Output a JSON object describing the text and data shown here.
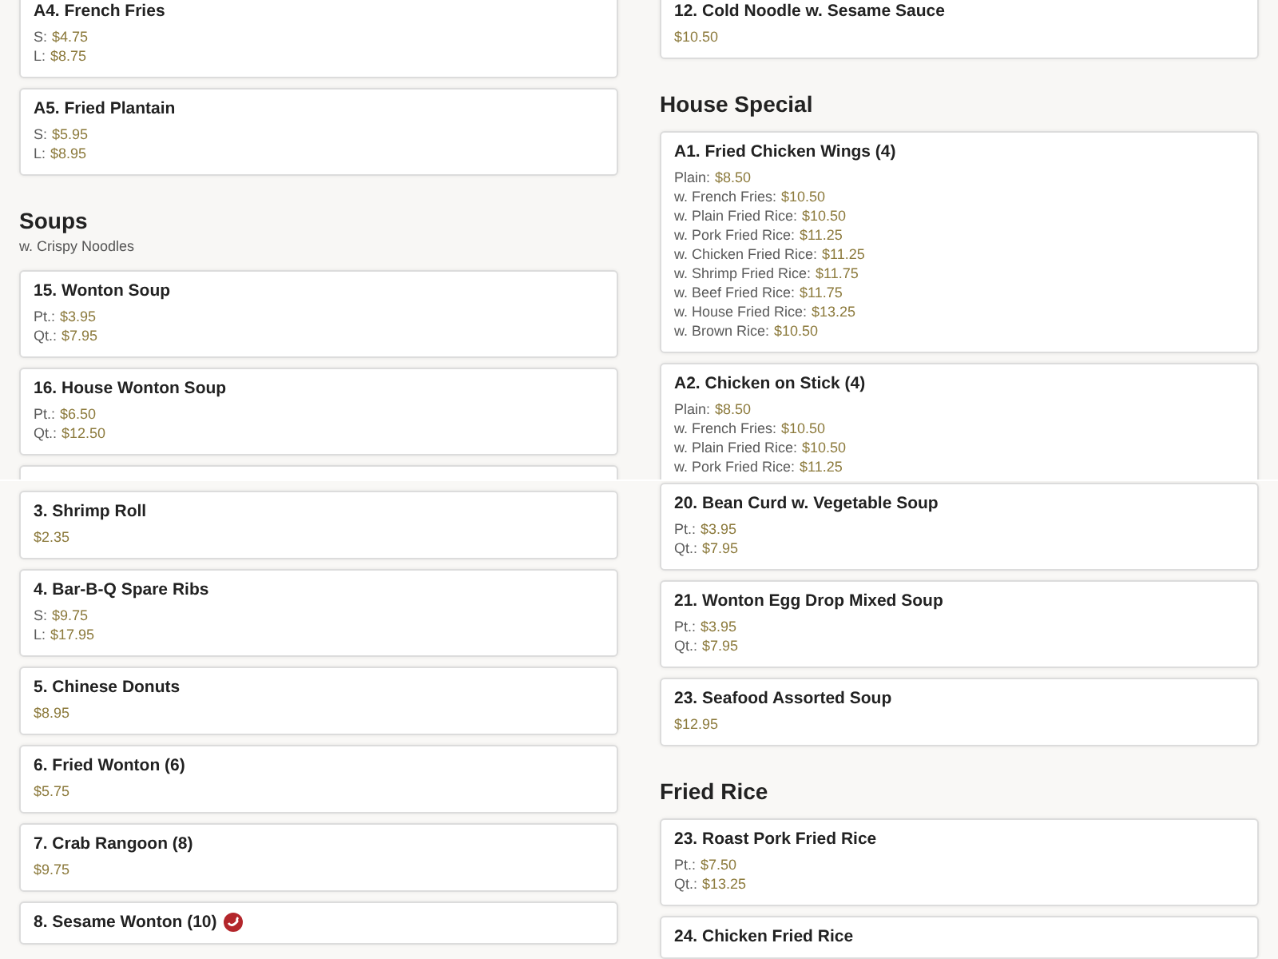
{
  "panels": [
    {
      "columns": [
        [
          {
            "kind": "card",
            "title": "A4. French Fries",
            "lines": [
              {
                "label": "S:",
                "price": "$4.75"
              },
              {
                "label": "L:",
                "price": "$8.75"
              }
            ]
          },
          {
            "kind": "card",
            "title": "A5. Fried Plantain",
            "lines": [
              {
                "label": "S:",
                "price": "$5.95"
              },
              {
                "label": "L:",
                "price": "$8.95"
              }
            ]
          },
          {
            "kind": "heading",
            "text": "Soups",
            "note": "w. Crispy Noodles"
          },
          {
            "kind": "card",
            "title": "15. Wonton Soup",
            "lines": [
              {
                "label": "Pt.:",
                "price": "$3.95"
              },
              {
                "label": "Qt.:",
                "price": "$7.95"
              }
            ]
          },
          {
            "kind": "card",
            "title": "16. House Wonton Soup",
            "lines": [
              {
                "label": "Pt.:",
                "price": "$6.50"
              },
              {
                "label": "Qt.:",
                "price": "$12.50"
              }
            ]
          },
          {
            "kind": "stub"
          }
        ],
        [
          {
            "kind": "card",
            "title": "12. Cold Noodle w. Sesame Sauce",
            "lines": [
              {
                "price": "$10.50"
              }
            ]
          },
          {
            "kind": "heading",
            "text": "House Special"
          },
          {
            "kind": "card",
            "title": "A1. Fried Chicken Wings (4)",
            "lines": [
              {
                "label": "Plain:",
                "price": "$8.50"
              },
              {
                "label": "w. French Fries:",
                "price": "$10.50"
              },
              {
                "label": "w. Plain Fried Rice:",
                "price": "$10.50"
              },
              {
                "label": "w. Pork Fried Rice:",
                "price": "$11.25"
              },
              {
                "label": "w. Chicken Fried Rice:",
                "price": "$11.25"
              },
              {
                "label": "w. Shrimp Fried Rice:",
                "price": "$11.75"
              },
              {
                "label": "w. Beef Fried Rice:",
                "price": "$11.75"
              },
              {
                "label": "w. House Fried Rice:",
                "price": "$13.25"
              },
              {
                "label": "w. Brown Rice:",
                "price": "$10.50"
              }
            ]
          },
          {
            "kind": "card",
            "title": "A2. Chicken on Stick (4)",
            "lines": [
              {
                "label": "Plain:",
                "price": "$8.50"
              },
              {
                "label": "w. French Fries:",
                "price": "$10.50"
              },
              {
                "label": "w. Plain Fried Rice:",
                "price": "$10.50"
              },
              {
                "label": "w. Pork Fried Rice:",
                "price": "$11.25"
              }
            ]
          }
        ]
      ]
    },
    {
      "columns": [
        [
          {
            "kind": "card",
            "title": "3. Shrimp Roll",
            "lines": [
              {
                "price": "$2.35"
              }
            ]
          },
          {
            "kind": "card",
            "title": "4. Bar-B-Q Spare Ribs",
            "lines": [
              {
                "label": "S:",
                "price": "$9.75"
              },
              {
                "label": "L:",
                "price": "$17.95"
              }
            ]
          },
          {
            "kind": "card",
            "title": "5. Chinese Donuts",
            "lines": [
              {
                "price": "$8.95"
              }
            ]
          },
          {
            "kind": "card",
            "title": "6. Fried Wonton (6)",
            "lines": [
              {
                "price": "$5.75"
              }
            ]
          },
          {
            "kind": "card",
            "title": "7. Crab Rangoon (8)",
            "lines": [
              {
                "price": "$9.75"
              }
            ]
          },
          {
            "kind": "card",
            "title": "8. Sesame Wonton (10)",
            "spicy": true
          }
        ],
        [
          {
            "kind": "card",
            "title": "20. Bean Curd w. Vegetable Soup",
            "lines": [
              {
                "label": "Pt.:",
                "price": "$3.95"
              },
              {
                "label": "Qt.:",
                "price": "$7.95"
              }
            ]
          },
          {
            "kind": "card",
            "title": "21. Wonton Egg Drop Mixed Soup",
            "lines": [
              {
                "label": "Pt.:",
                "price": "$3.95"
              },
              {
                "label": "Qt.:",
                "price": "$7.95"
              }
            ]
          },
          {
            "kind": "card",
            "title": "23. Seafood Assorted Soup",
            "lines": [
              {
                "price": "$12.95"
              }
            ]
          },
          {
            "kind": "heading",
            "text": "Fried Rice"
          },
          {
            "kind": "card",
            "title": "23. Roast Pork Fried Rice",
            "lines": [
              {
                "label": "Pt.:",
                "price": "$7.50"
              },
              {
                "label": "Qt.:",
                "price": "$13.25"
              }
            ]
          },
          {
            "kind": "card",
            "title": "24. Chicken Fried Rice"
          }
        ]
      ]
    }
  ]
}
